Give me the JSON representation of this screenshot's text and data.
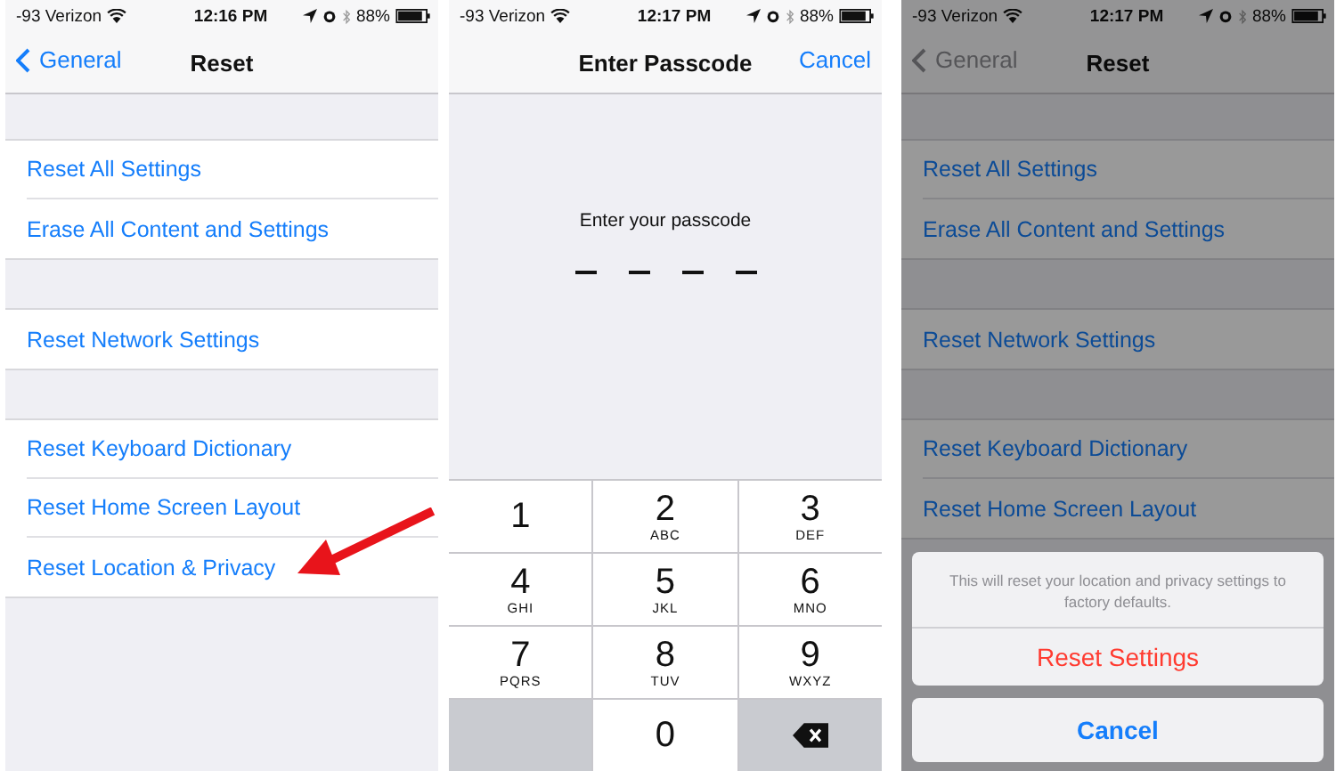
{
  "screens": [
    {
      "kind": "settings",
      "dimmed": false,
      "status_bar": {
        "carrier": "-93 Verizon",
        "time": "12:16 PM",
        "battery": "88%"
      },
      "nav": {
        "back": "General",
        "title": "Reset"
      },
      "groups": [
        {
          "items": [
            "Reset All Settings",
            "Erase All Content and Settings"
          ]
        },
        {
          "items": [
            "Reset Network Settings"
          ]
        },
        {
          "items": [
            "Reset Keyboard Dictionary",
            "Reset Home Screen Layout",
            "Reset Location & Privacy"
          ]
        }
      ]
    },
    {
      "kind": "passcode",
      "status_bar": {
        "carrier": "-93 Verizon",
        "time": "12:17 PM",
        "battery": "88%"
      },
      "nav": {
        "title": "Enter Passcode",
        "right": "Cancel"
      },
      "prompt": "Enter your passcode",
      "keys": [
        {
          "kind": "digit",
          "digit": "1"
        },
        {
          "kind": "digit",
          "digit": "2",
          "letters": "ABC"
        },
        {
          "kind": "digit",
          "digit": "3",
          "letters": "DEF"
        },
        {
          "kind": "digit",
          "digit": "4",
          "letters": "GHI"
        },
        {
          "kind": "digit",
          "digit": "5",
          "letters": "JKL"
        },
        {
          "kind": "digit",
          "digit": "6",
          "letters": "MNO"
        },
        {
          "kind": "digit",
          "digit": "7",
          "letters": "PQRS"
        },
        {
          "kind": "digit",
          "digit": "8",
          "letters": "TUV"
        },
        {
          "kind": "digit",
          "digit": "9",
          "letters": "WXYZ"
        },
        {
          "kind": "blank"
        },
        {
          "kind": "digit",
          "digit": "0"
        },
        {
          "kind": "delete"
        }
      ]
    },
    {
      "kind": "settings",
      "dimmed": true,
      "status_bar": {
        "carrier": "-93 Verizon",
        "time": "12:17 PM",
        "battery": "88%"
      },
      "nav": {
        "back": "General",
        "title": "Reset"
      },
      "groups": [
        {
          "items": [
            "Reset All Settings",
            "Erase All Content and Settings"
          ]
        },
        {
          "items": [
            "Reset Network Settings"
          ]
        },
        {
          "items": [
            "Reset Keyboard Dictionary",
            "Reset Home Screen Layout"
          ]
        }
      ],
      "action_sheet": {
        "message": "This will reset your location and privacy settings to factory defaults.",
        "action": "Reset Settings",
        "cancel": "Cancel"
      }
    }
  ]
}
